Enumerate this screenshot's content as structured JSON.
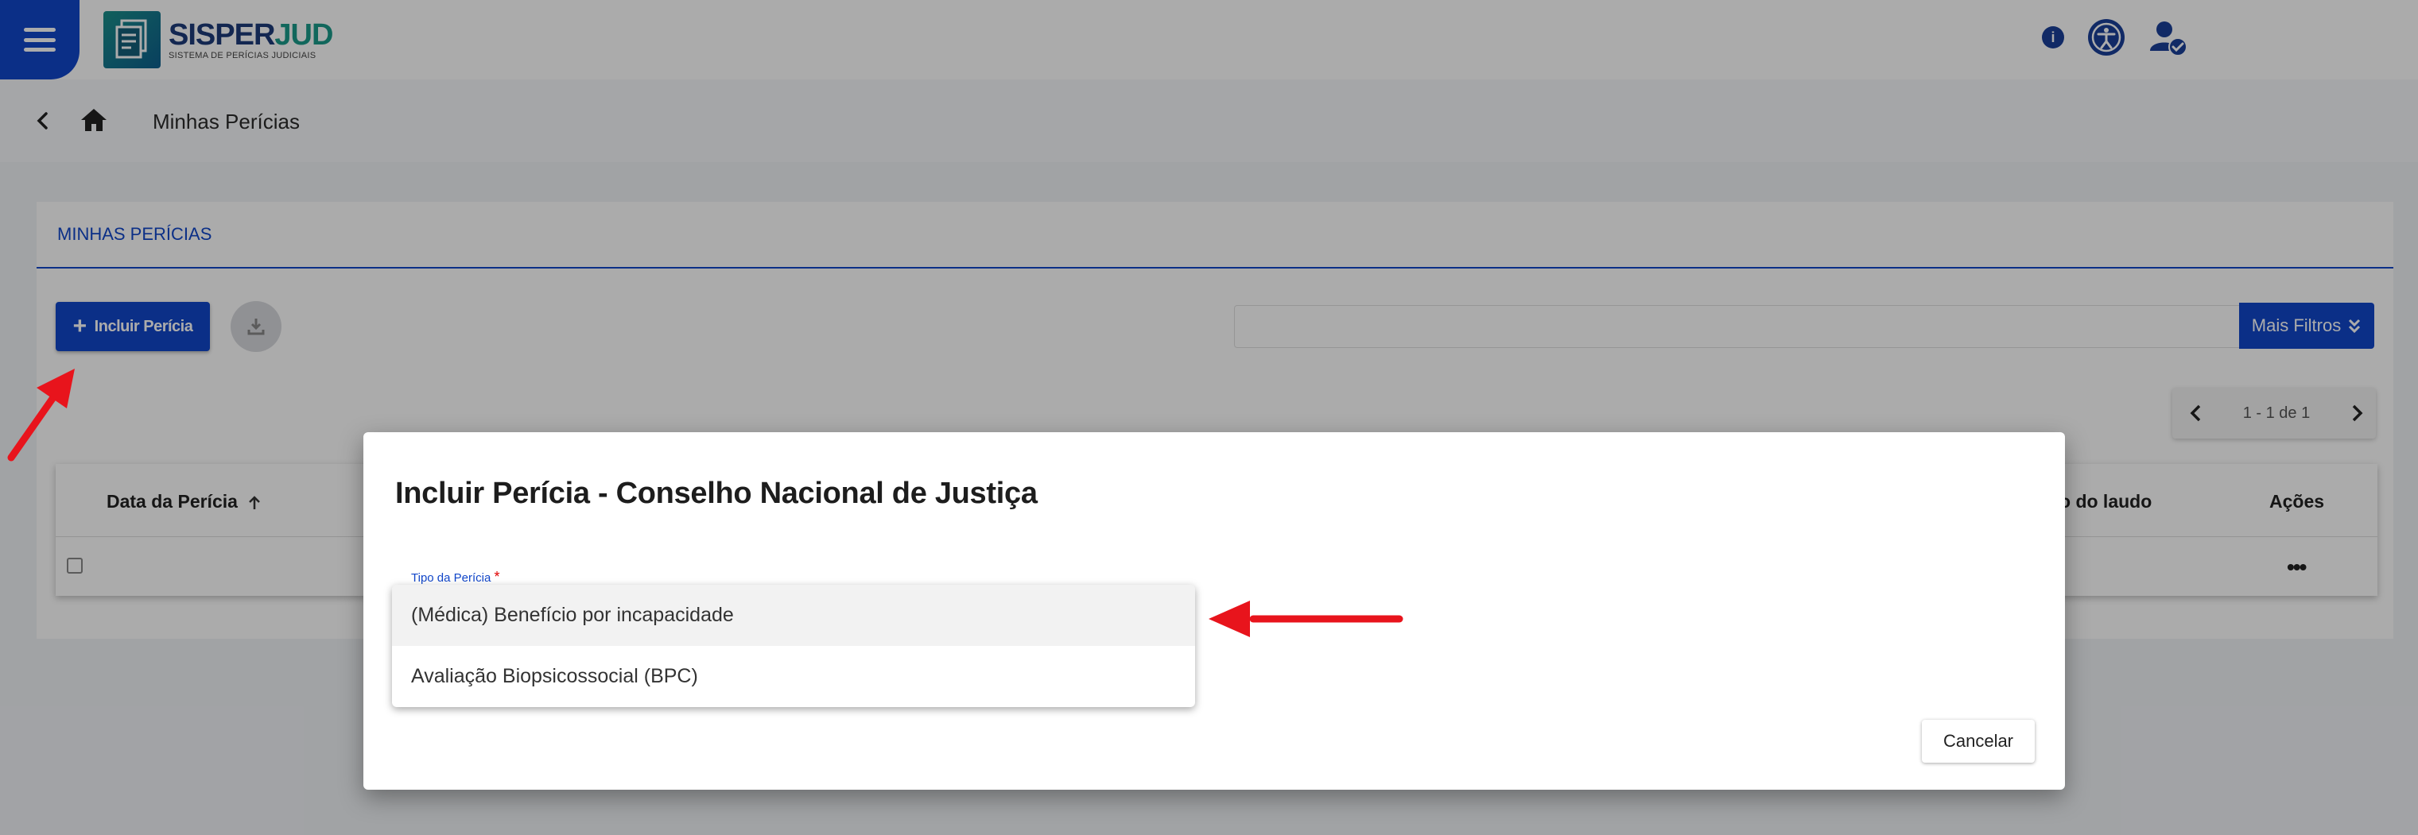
{
  "header": {
    "logo_title_a": "SISPER",
    "logo_title_b": "JUD",
    "logo_subtitle": "SISTEMA DE PERÍCIAS JUDICIAIS",
    "info_glyph": "i"
  },
  "breadcrumb": {
    "title": "Minhas Perícias"
  },
  "card": {
    "heading": "MINHAS PERÍCIAS",
    "add_button": "Incluir Perícia",
    "add_button_glyph": "+",
    "more_filters": "Mais Filtros",
    "pagination": "1 - 1 de 1",
    "columns": {
      "date": "Data da Perícia",
      "laudo": "o do laudo",
      "actions": "Ações"
    },
    "row_actions": "•••"
  },
  "modal": {
    "title": "Incluir Perícia - Conselho Nacional de Justiça",
    "field_label": "Tipo da Perícia",
    "required_mark": "*",
    "options": [
      "(Médica) Benefício por incapacidade",
      "Avaliação Biopsicossocial (BPC)"
    ],
    "cancel": "Cancelar"
  },
  "colors": {
    "primary": "#1146c9",
    "arrow": "#e8141c",
    "accent_teal": "#1a9a8a"
  },
  "icons": [
    "menu-icon",
    "info-icon",
    "accessibility-icon",
    "user-settings-icon",
    "back-chevron-icon",
    "home-icon",
    "plus-icon",
    "download-icon",
    "double-chevron-down-icon",
    "chevron-left-icon",
    "chevron-right-icon",
    "sort-up-icon",
    "more-icon"
  ]
}
